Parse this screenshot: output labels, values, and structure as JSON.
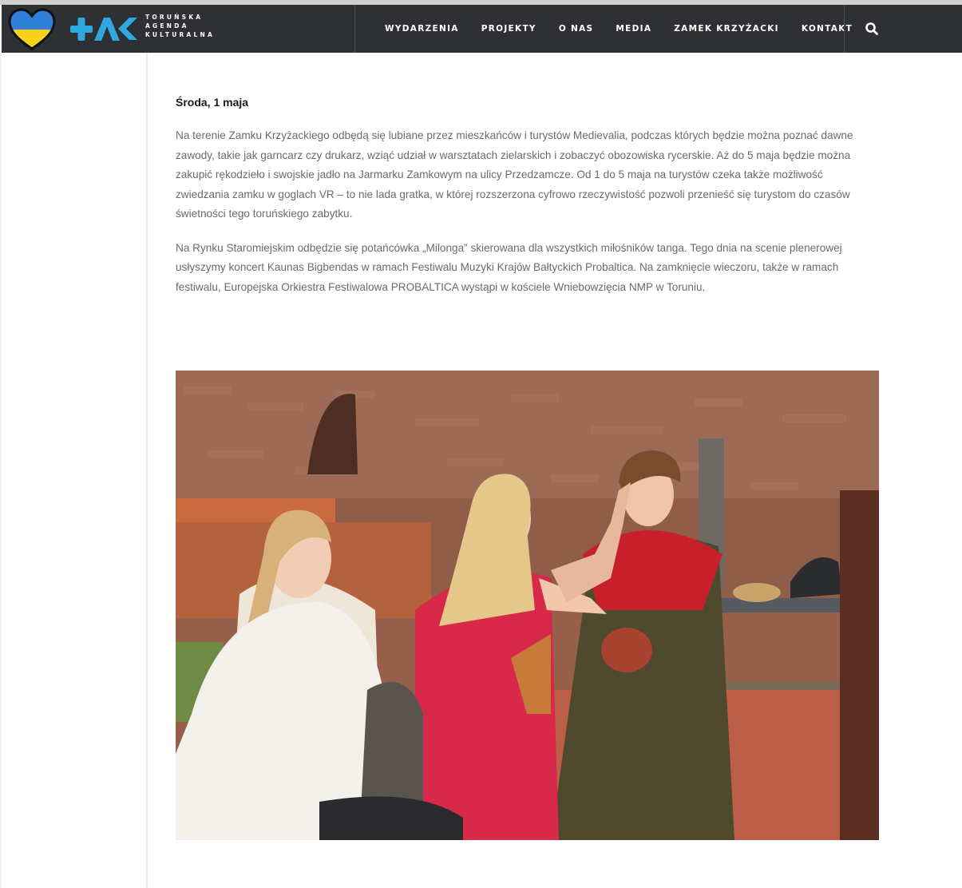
{
  "brand": {
    "logo_lines": [
      "TORUŃSKA",
      "AGENDA",
      "KULTURALNA"
    ],
    "colors": {
      "navbar": "#2e3033",
      "blue": "#2fa8e0",
      "yellow": "#f6d21b"
    }
  },
  "nav": {
    "items": [
      {
        "label": "WYDARZENIA"
      },
      {
        "label": "PROJEKTY"
      },
      {
        "label": "O NAS"
      },
      {
        "label": "MEDIA"
      },
      {
        "label": "ZAMEK KRZYŻACKI"
      },
      {
        "label": "KONTAKT"
      }
    ],
    "search_icon": "search-icon"
  },
  "article": {
    "date_heading": "Środa, 1 maja",
    "paragraphs": [
      "Na terenie Zamku Krzyżackiego odbędą się lubiane przez mieszkańców i turystów Medievalia, podczas których będzie można poznać dawne zawody, takie jak garncarz czy drukarz, wziąć udział w warsztatach zielarskich i zobaczyć obozowiska rycerskie. Aż do 5 maja będzie można zakupić rękodzieło i swojskie jadło na Jarmarku Zamkowym na ulicy Przedzamcze. Od 1 do 5 maja na turystów czeka także możliwość zwiedzania zamku w goglach VR – to nie lada gratka, w której rozszerzona cyfrowo rzeczywistość pozwoli przenieść się turystom do czasów świetności tego toruńskiego zabytku.",
      "Na Rynku Staromiejskim odbędzie się potańcówka „Milonga” skierowana dla wszystkich miłośników tanga. Tego dnia na scenie plenerowej usłyszymy koncert Kaunas Bigbendas w ramach Festiwalu Muzyki Krajów Bałtyckich Probaltica. Na zamknięcie wieczoru, także w ramach festiwalu, Europejska Orkiestra Festiwalowa PROBALTICA wystąpi w kościele Wniebowzięcia NMP w Toruniu."
    ]
  }
}
